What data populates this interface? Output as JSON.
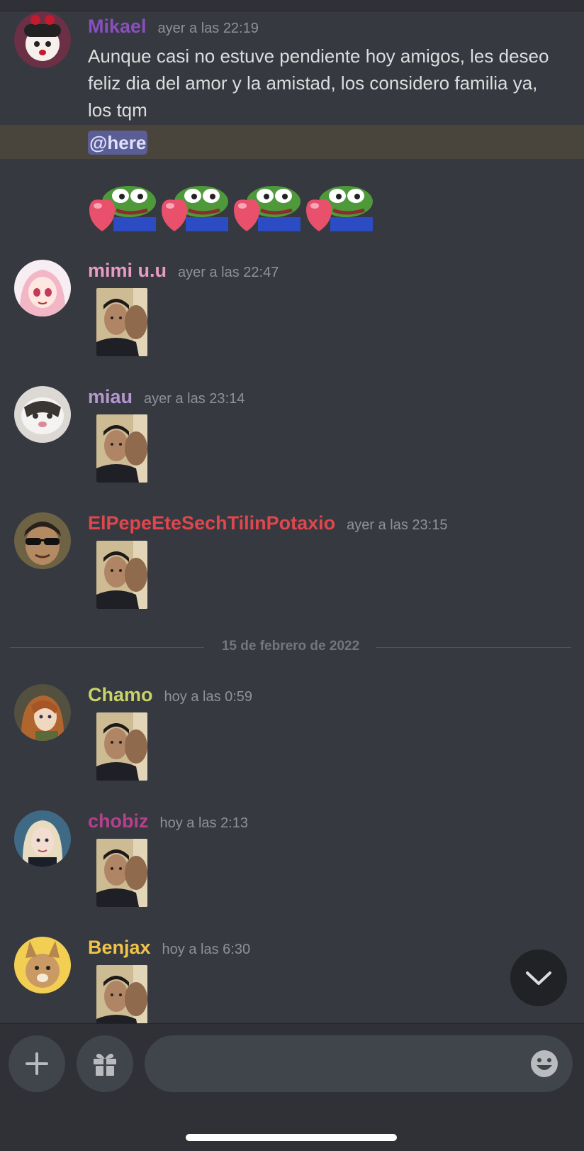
{
  "messages": [
    {
      "author": "Mikael",
      "author_color": "#8a4fbf",
      "timestamp": "ayer a las 22:19",
      "text": "Aunque casi no estuve pendiente hoy amigos, les deseo feliz dia del amor y la amistad, los considero familia ya, los tqm",
      "mention": "@here",
      "emotes": [
        "pepe-heart-emote",
        "pepe-heart-emote",
        "pepe-heart-emote",
        "pepe-heart-emote"
      ]
    },
    {
      "author": "mimi u.u",
      "author_color": "#e89bc4",
      "timestamp": "ayer a las 22:47",
      "attachment": "photo"
    },
    {
      "author": "miau",
      "author_color": "#b497cf",
      "timestamp": "ayer a las 23:14",
      "attachment": "photo"
    },
    {
      "author": "ElPepeEteSechTilinPotaxio",
      "author_color": "#e0474d",
      "timestamp": "ayer a las 23:15",
      "attachment": "photo"
    },
    {
      "author": "Chamo",
      "author_color": "#c9d36a",
      "timestamp": "hoy a las 0:59",
      "attachment": "photo"
    },
    {
      "author": "chobiz",
      "author_color": "#b6408f",
      "timestamp": "hoy a las 2:13",
      "attachment": "photo"
    },
    {
      "author": "Benjax",
      "author_color": "#f0c349",
      "timestamp": "hoy a las 6:30",
      "attachment": "photo"
    }
  ],
  "date_divider": "15 de febrero de 2022",
  "composer": {
    "placeholder": "",
    "add_icon": "plus-icon",
    "gift_icon": "gift-icon",
    "emoji_icon": "emoji-icon"
  },
  "scroll_icon": "chevron-down-icon"
}
